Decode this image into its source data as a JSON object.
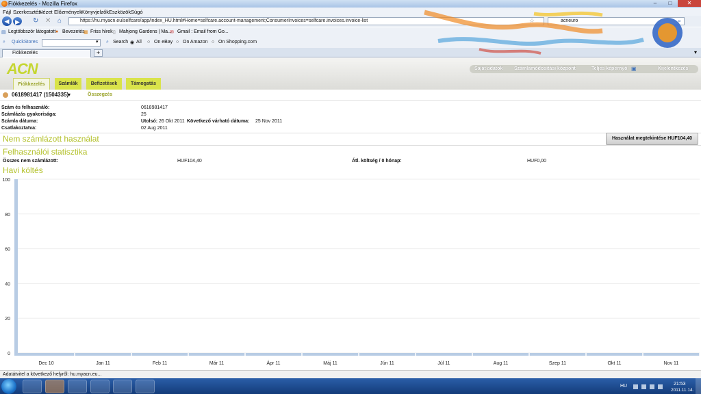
{
  "window": {
    "title": "Fiókkezelés - Mozilla Firefox"
  },
  "menubar": {
    "items": [
      "Fájl",
      "Szerkesztés",
      "Nézet",
      "Előzmények",
      "Könyvjelzők",
      "Eszközök",
      "Súgó"
    ]
  },
  "navbar": {
    "url": "https://hu.myacn.eu/selfcare/app/index_HU.html#Home=selfcare.account-management;ConsumerInvoices=selfcare.invoices.invoice-list",
    "search_value": "acneuro"
  },
  "bookmarks": [
    "Legtöbbször látogatott",
    "Bevezetés",
    "Friss hírek",
    "Mahjong Gardens | Ma...",
    "Gmail : Email from Go..."
  ],
  "quickstores": {
    "label": "QuickStores",
    "search_button": "Search",
    "options": [
      "All",
      "On eBay",
      "On Amazon",
      "On Shopping.com"
    ]
  },
  "tabs": [
    {
      "label": "Fiókkezelés"
    }
  ],
  "site": {
    "logo": "ACN",
    "toplinks": [
      "Saját adatok",
      "Számlamódosítási központ",
      "Teljes képernyő",
      "Kijelentkezés"
    ],
    "nav": [
      "Fiókkezelés",
      "Számlák",
      "Befizetések",
      "Támogatás"
    ]
  },
  "account": {
    "label": "0618981417 (1504335)",
    "summary_link": "Összegzés"
  },
  "details": {
    "number_user_label": "Szám és felhasználó:",
    "number_user_value": "0618981417",
    "freq_label": "Számlázás gyakorisága:",
    "freq_value": "25",
    "date_label": "Számla dátuma:",
    "last_label": "Utolsó:",
    "last_value": "26 Okt 2011",
    "next_label": "Következő várható dátuma:",
    "next_value": "25 Nov 2011",
    "connected_label": "Csatlakoztatva:",
    "connected_value": "02 Aug 2011"
  },
  "unbilled": {
    "heading": "Nem számlázott használat",
    "button": "Használat megtekintése HUF104,40"
  },
  "stats": {
    "heading": "Felhasználói statisztika",
    "total_label": "Összes nem számlázott:",
    "total_value": "HUF104,40",
    "avg_label": "Átl. költség / 0 hónap:",
    "avg_value": "HUF0,00"
  },
  "monthly": {
    "heading": "Havi költés"
  },
  "chart_data": {
    "type": "bar",
    "title": "",
    "categories": [
      "Dec 10",
      "Jan 11",
      "Feb 11",
      "Már 11",
      "Ápr 11",
      "Máj 11",
      "Jún 11",
      "Júl 11",
      "Aug 11",
      "Szep 11",
      "Okt 11",
      "Nov 11"
    ],
    "values": [
      0,
      0,
      0,
      0,
      0,
      0,
      0,
      0,
      0,
      0,
      0,
      0
    ],
    "yticks": [
      "0",
      "20",
      "40",
      "60",
      "80",
      "100"
    ],
    "ylim": [
      0,
      100
    ],
    "grid": true,
    "colors": {
      "axis": "#b8cce4",
      "grid": "#eeeeee"
    }
  },
  "statusbar": {
    "text": "Adatátvitel a következő helyről: hu.myacn.eu..."
  },
  "taskbar": {
    "lang": "HU",
    "time": "21:53",
    "date": "2011.11.14."
  }
}
